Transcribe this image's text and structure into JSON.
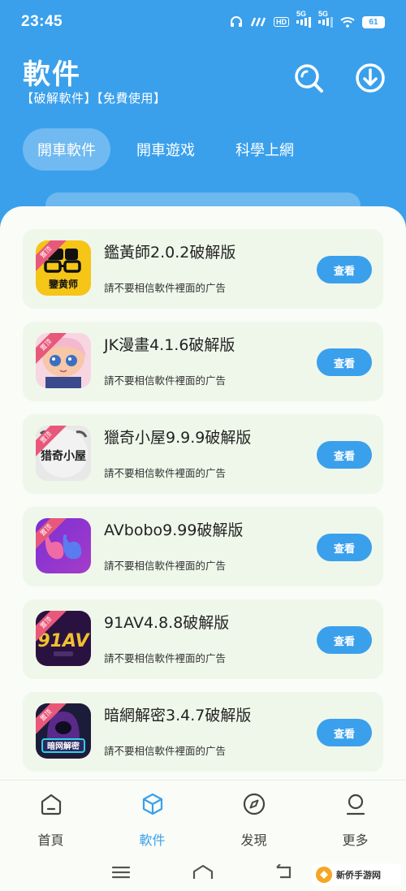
{
  "status_bar": {
    "time": "23:45",
    "hd": "HD",
    "net1": "5G",
    "net2": "5G",
    "battery": "61"
  },
  "header": {
    "title": "軟件",
    "subtitle": "【破解軟件】【免費使用】",
    "tabs": [
      {
        "label": "開車軟件",
        "active": true
      },
      {
        "label": "開車遊戏",
        "active": false
      },
      {
        "label": "科學上網",
        "active": false
      }
    ],
    "icons": [
      "search-icon",
      "download-icon"
    ]
  },
  "apps": [
    {
      "name": "鑑黃師2.0.2破解版",
      "desc": "請不要相信軟件裡面的广告",
      "button": "查看",
      "icon": "jianhuangshi-app-icon",
      "icon_text": "鑒黄师",
      "icon_color": "#f5c518"
    },
    {
      "name": "JK漫畫4.1.6破解版",
      "desc": "請不要相信軟件裡面的广告",
      "button": "查看",
      "icon": "jk-manga-app-icon",
      "icon_color": "#f7d6e2"
    },
    {
      "name": "獵奇小屋9.9.9破解版",
      "desc": "請不要相信軟件裡面的广告",
      "button": "查看",
      "icon": "lieqi-xiaowu-app-icon",
      "icon_text": "猎奇小屋",
      "icon_color": "#e8e8e8"
    },
    {
      "name": "AVbobo9.99破解版",
      "desc": "請不要相信軟件裡面的广告",
      "button": "查看",
      "icon": "avbobo-app-icon",
      "icon_color": "#8a2be2"
    },
    {
      "name": "91AV4.8.8破解版",
      "desc": "請不要相信軟件裡面的广告",
      "button": "查看",
      "icon": "91av-app-icon",
      "icon_text": "91AV",
      "icon_color": "#2a1240"
    },
    {
      "name": "暗網解密3.4.7破解版",
      "desc": "請不要相信軟件裡面的广告",
      "button": "查看",
      "icon": "darkweb-app-icon",
      "icon_text": "暗网解密",
      "icon_color": "#1d1b3a"
    }
  ],
  "ribbon_text": "置顶",
  "bottom_nav": [
    {
      "label": "首頁",
      "icon": "home-icon",
      "active": false
    },
    {
      "label": "軟件",
      "icon": "box-icon",
      "active": true
    },
    {
      "label": "发現",
      "icon": "compass-icon",
      "active": false
    },
    {
      "label": "更多",
      "icon": "profile-icon",
      "active": false
    }
  ],
  "watermark": "新侨手游网",
  "colors": {
    "accent": "#3aa0ec",
    "card_bg": "#eff7ea",
    "sheet_bg": "#f9fcf7"
  }
}
